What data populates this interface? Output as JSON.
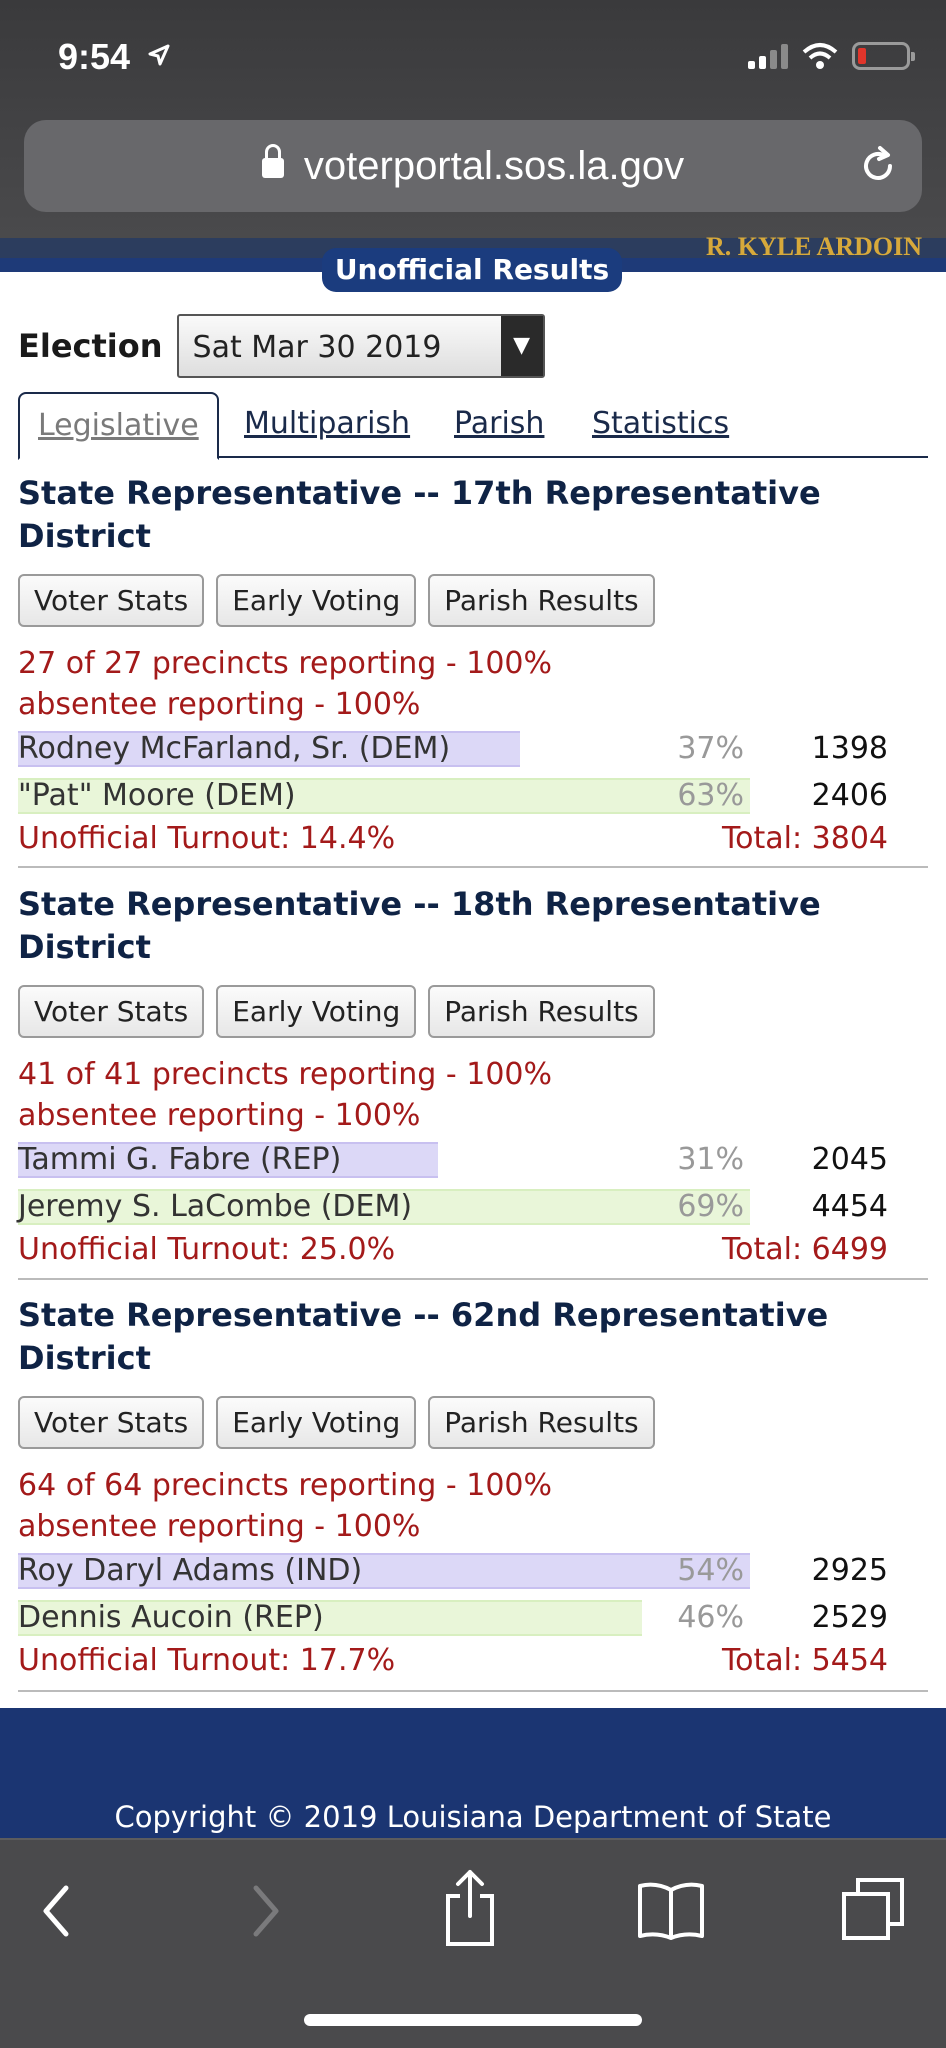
{
  "status_bar": {
    "time": "9:54"
  },
  "browser": {
    "url": "voterportal.sos.la.gov"
  },
  "banner": {
    "name": "R. KYLE ARDOIN",
    "badge": "Unofficial Results"
  },
  "election": {
    "label": "Election",
    "selected": "Sat Mar 30 2019"
  },
  "tabs": [
    "Legislative",
    "Multiparish",
    "Parish",
    "Statistics"
  ],
  "race_buttons": [
    "Voter Stats",
    "Early Voting",
    "Parish Results"
  ],
  "races": [
    {
      "title": "State Representative -- 17th Representative District",
      "precincts": "27 of 27 precincts reporting - 100%",
      "absentee": "absentee reporting - 100%",
      "candidates": [
        {
          "name": "Rodney McFarland, Sr. (DEM)",
          "pct": "37%",
          "votes": "1398",
          "share": 37
        },
        {
          "name": "\"Pat\" Moore (DEM)",
          "pct": "63%",
          "votes": "2406",
          "share": 63
        }
      ],
      "turnout": "Unofficial Turnout: 14.4%",
      "total": "Total: 3804"
    },
    {
      "title": "State Representative -- 18th Representative District",
      "precincts": "41 of 41 precincts reporting - 100%",
      "absentee": "absentee reporting - 100%",
      "candidates": [
        {
          "name": "Tammi G. Fabre (REP)",
          "pct": "31%",
          "votes": "2045",
          "share": 31
        },
        {
          "name": "Jeremy S. LaCombe (DEM)",
          "pct": "69%",
          "votes": "4454",
          "share": 69
        }
      ],
      "turnout": "Unofficial Turnout: 25.0%",
      "total": "Total: 6499"
    },
    {
      "title": "State Representative -- 62nd Representative District",
      "precincts": "64 of 64 precincts reporting - 100%",
      "absentee": "absentee reporting - 100%",
      "candidates": [
        {
          "name": "Roy Daryl Adams (IND)",
          "pct": "54%",
          "votes": "2925",
          "share": 54
        },
        {
          "name": "Dennis Aucoin (REP)",
          "pct": "46%",
          "votes": "2529",
          "share": 46
        }
      ],
      "turnout": "Unofficial Turnout: 17.7%",
      "total": "Total: 5454"
    }
  ],
  "footer": {
    "copyright": "Copyright © 2019 Louisiana Department of State"
  },
  "colors": {
    "accent_navy": "#1b3572",
    "results_red": "#a31a1a",
    "bar_purple": "#dcd8f7",
    "bar_green": "#e9f6d9"
  }
}
